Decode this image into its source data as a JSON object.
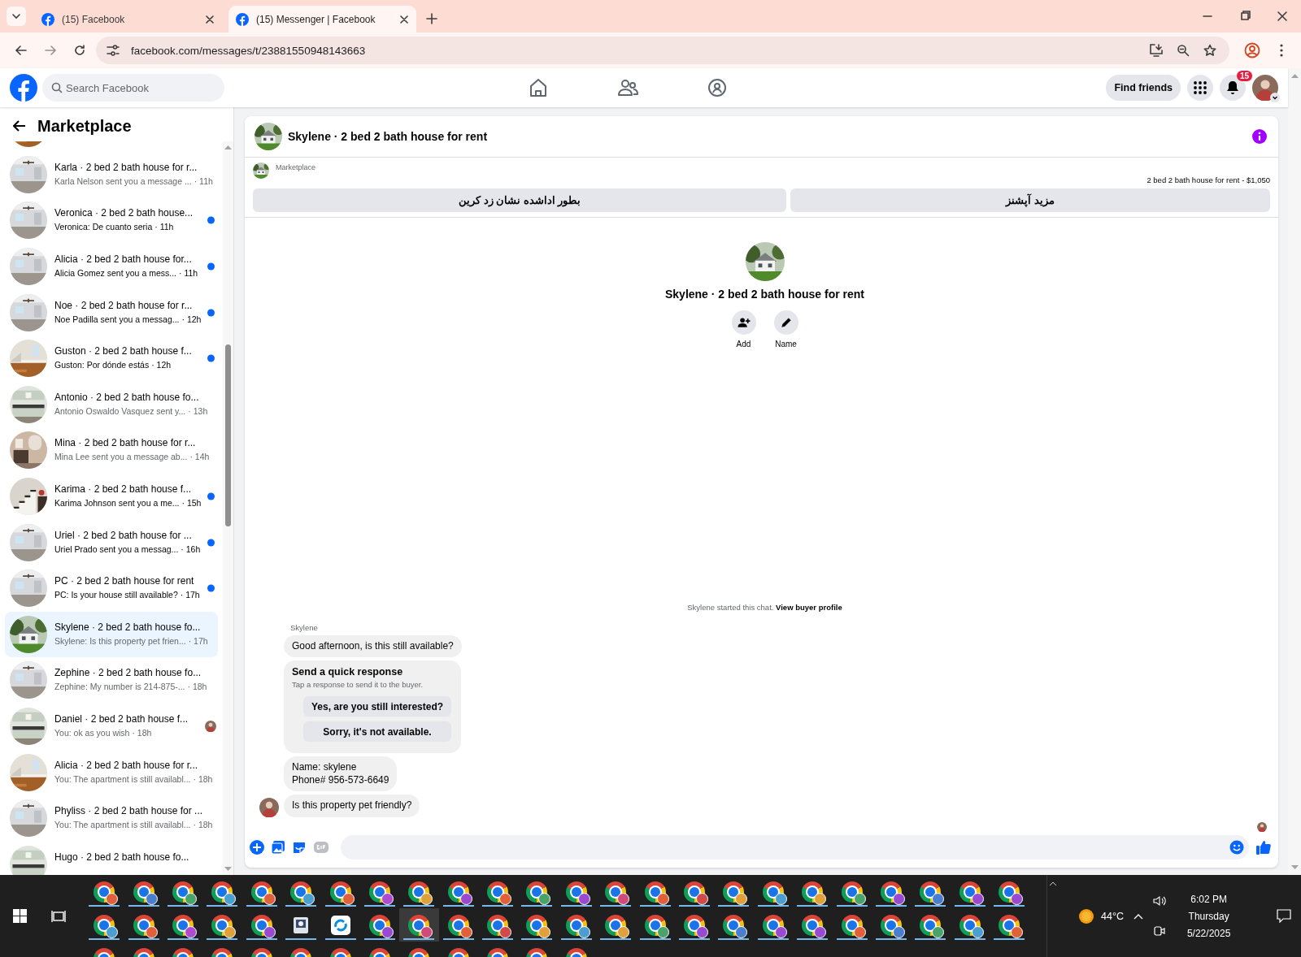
{
  "browser": {
    "tabs": [
      {
        "title": "(15) Facebook",
        "selected": false
      },
      {
        "title": "(15) Messenger | Facebook",
        "selected": true
      }
    ],
    "url": "facebook.com/messages/t/23881550948143663"
  },
  "topbar": {
    "search": {
      "placeholder": "Search Facebook"
    },
    "find_friends": "Find friends",
    "notification_count": "15"
  },
  "sidebar": {
    "title": "Marketplace",
    "conversations": [
      {
        "title": "Karla · 2 bed 2 bath house for r...",
        "preview": "Karla Nelson sent you a message ...",
        "time": "· 11h",
        "unread": false,
        "seen": false,
        "selected": false
      },
      {
        "title": "Veronica · 2 bed 2 bath house...",
        "preview": "Veronica: De cuanto seria",
        "time": "· 11h",
        "unread": true,
        "seen": false,
        "selected": false
      },
      {
        "title": "Alicia · 2 bed 2 bath house for...",
        "preview": "Alicia Gomez sent you a mess...",
        "time": "· 11h",
        "unread": true,
        "seen": false,
        "selected": false
      },
      {
        "title": "Noe · 2 bed 2 bath house for r...",
        "preview": "Noe Padilla sent you a messag...",
        "time": "· 12h",
        "unread": true,
        "seen": false,
        "selected": false
      },
      {
        "title": "Guston · 2 bed 2 bath house f...",
        "preview": "Guston: Por dónde estás",
        "time": "· 12h",
        "unread": true,
        "seen": false,
        "selected": false
      },
      {
        "title": "Antonio · 2 bed 2 bath house fo...",
        "preview": "Antonio Oswaldo Vasquez sent y...",
        "time": "· 13h",
        "unread": false,
        "seen": false,
        "selected": false
      },
      {
        "title": "Mina · 2 bed 2 bath house for r...",
        "preview": "Mina Lee sent you a message ab...",
        "time": "· 14h",
        "unread": false,
        "seen": false,
        "selected": false
      },
      {
        "title": "Karima · 2 bed 2 bath house f...",
        "preview": "Karima Johnson sent you a me...",
        "time": "· 15h",
        "unread": true,
        "seen": false,
        "selected": false
      },
      {
        "title": "Uriel · 2 bed 2 bath house for ...",
        "preview": "Uriel Prado sent you a messag...",
        "time": "· 16h",
        "unread": true,
        "seen": false,
        "selected": false
      },
      {
        "title": "PC · 2 bed 2 bath house for rent",
        "preview": "PC: Is your house still available?",
        "time": "· 17h",
        "unread": true,
        "seen": false,
        "selected": false
      },
      {
        "title": "Skylene · 2 bed 2 bath house fo...",
        "preview": "Skylene: Is this property pet frien...",
        "time": "· 17h",
        "unread": false,
        "seen": false,
        "selected": true
      },
      {
        "title": "Zephine · 2 bed 2 bath house fo...",
        "preview": "Zephine: My number is 214-875-...",
        "time": "· 18h",
        "unread": false,
        "seen": false,
        "selected": false
      },
      {
        "title": "Daniel · 2 bed 2 bath house f...",
        "preview": "You: ok as you wish",
        "time": "· 18h",
        "unread": false,
        "seen": true,
        "selected": false
      },
      {
        "title": "Alicia · 2 bed 2 bath house for r...",
        "preview": "You: The apartment is still availabl...",
        "time": "· 18h",
        "unread": false,
        "seen": false,
        "selected": false
      },
      {
        "title": "Phyliss · 2 bed 2 bath house for ...",
        "preview": "You: The apartment is still availabl...",
        "time": "· 18h",
        "unread": false,
        "seen": false,
        "selected": false
      },
      {
        "title": "Hugo · 2 bed 2 bath house fo...",
        "unread": false,
        "seen": false,
        "selected": false
      }
    ]
  },
  "chat": {
    "title": "Skylene · 2 bed 2 bath house for rent",
    "listing": {
      "source": "Marketplace",
      "summary": "2 bed 2 bath house for rent - $1,050",
      "actions": [
        "مزید آپشنز",
        "بطور اداشده نشان زد کرین"
      ]
    },
    "profile": {
      "title": "Skylene · 2 bed 2 bath house for rent",
      "actions": [
        {
          "kind": "add_person",
          "label": "Add"
        },
        {
          "kind": "edit",
          "label": "Name"
        }
      ]
    },
    "started": {
      "text": "Skylene started this chat.",
      "link": "View buyer profile"
    },
    "sender": "Skylene",
    "messages": [
      {
        "kind": "text",
        "text": "Good afternoon, is this still available?",
        "avatar": false
      },
      {
        "kind": "quick_response",
        "title": "Send a quick response",
        "subtitle": "Tap a response to send it to the buyer.",
        "options": [
          "Yes, are you still interested?",
          "Sorry, it's not available."
        ]
      },
      {
        "kind": "text",
        "text": "Name: skylene\nPhone# 956-573-6649",
        "avatar": false
      },
      {
        "kind": "text",
        "text": "Is this property pet friendly?",
        "avatar": true
      }
    ]
  },
  "taskbar": {
    "weather": "44°C",
    "time": "6:02 PM",
    "day": "Thursday",
    "date": "5/22/2025"
  }
}
